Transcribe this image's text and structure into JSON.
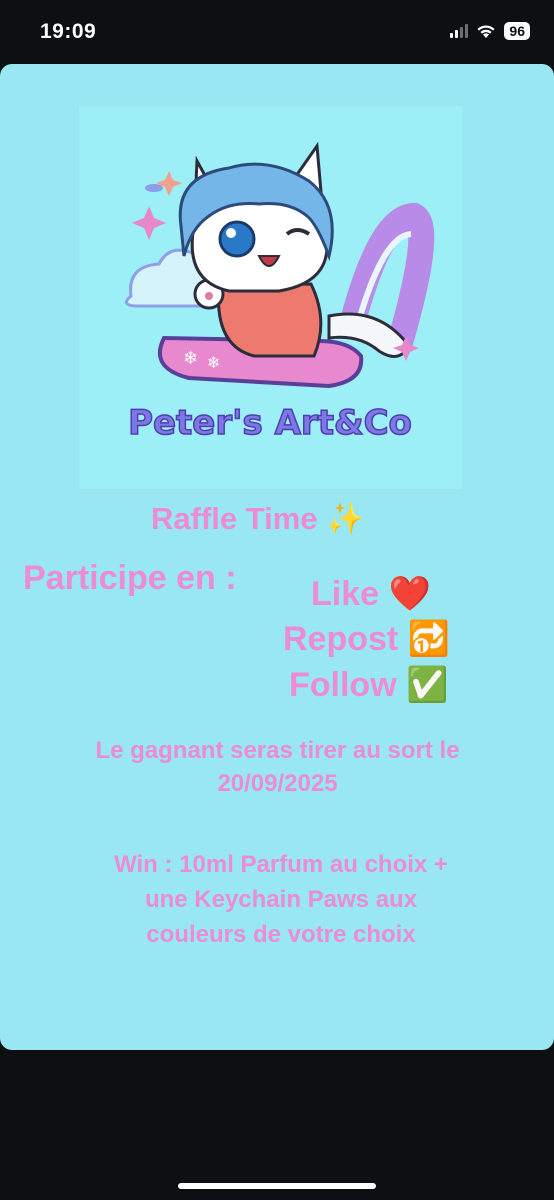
{
  "status_bar": {
    "time": "19:09",
    "battery_level": "96",
    "icons": [
      "signal-icon",
      "wifi-icon",
      "battery-icon"
    ]
  },
  "story": {
    "logo_text": "Peter's Art&Co",
    "raffle_title": "Raffle Time ✨",
    "participe_label": "Participe en :",
    "actions": [
      "Like ❤️",
      "Repost 🔂",
      "Follow ✅"
    ],
    "gagnant_text": "Le gagnant seras tirer au sort  le 20/09/2025",
    "win_text": "Win : 10ml Parfum au choix  + une Keychain Paws aux couleurs de votre choix"
  },
  "colors": {
    "background": "#0d1013",
    "card": "#99e7f2",
    "text_pink": "#ec8bd6"
  }
}
